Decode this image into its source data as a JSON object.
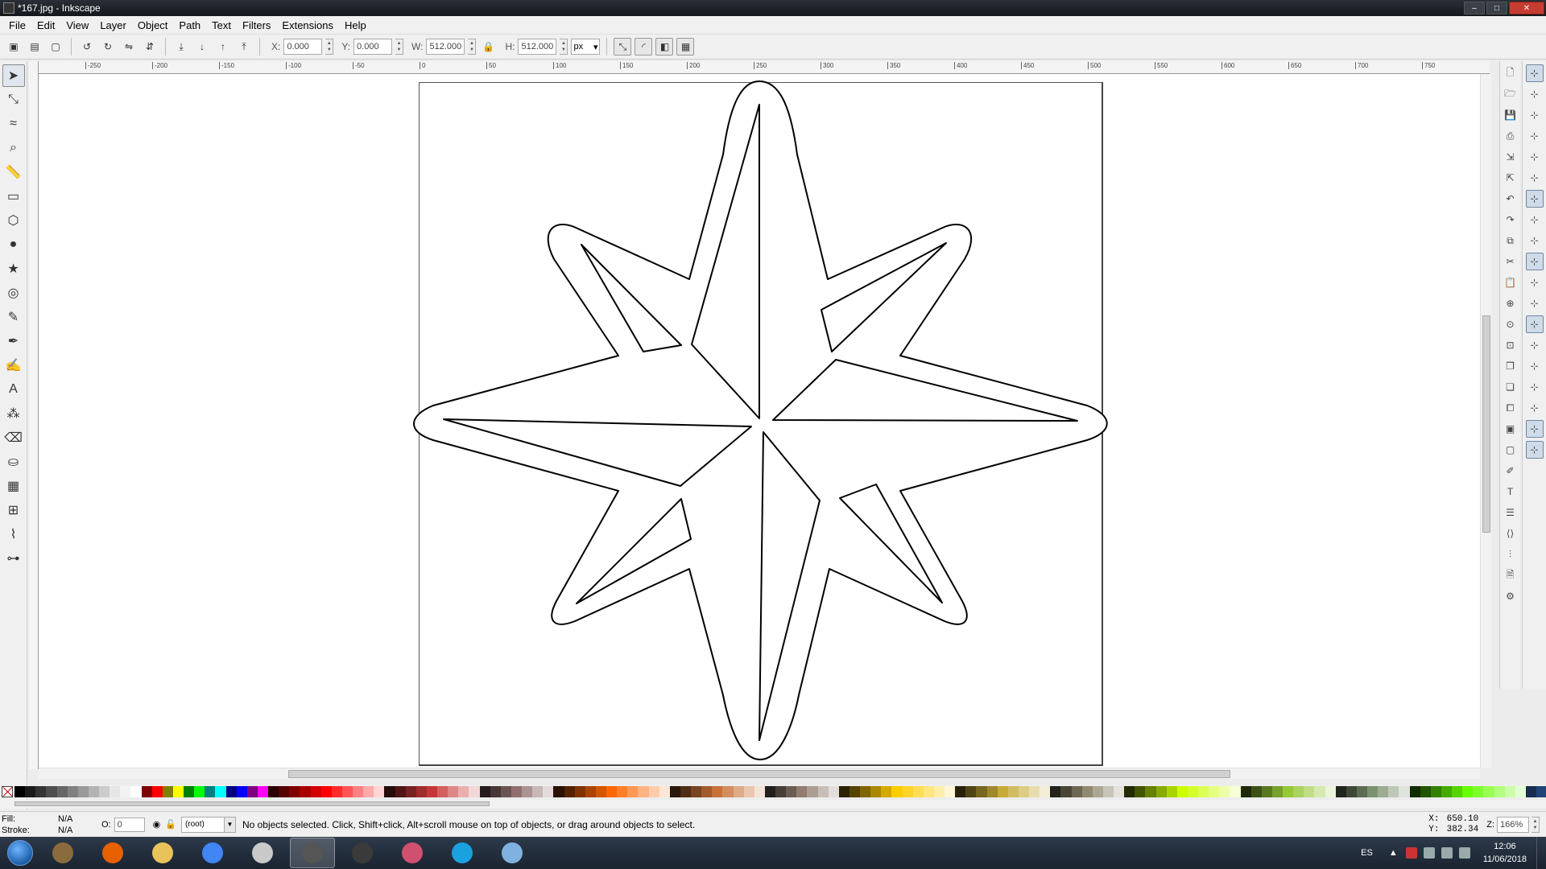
{
  "window": {
    "title": "*167.jpg - Inkscape",
    "min_glyph": "–",
    "max_glyph": "□",
    "close_glyph": "✕"
  },
  "menu": [
    "File",
    "Edit",
    "View",
    "Layer",
    "Object",
    "Path",
    "Text",
    "Filters",
    "Extensions",
    "Help"
  ],
  "controls": {
    "x_label": "X:",
    "x_value": "0.000",
    "y_label": "Y:",
    "y_value": "0.000",
    "w_label": "W:",
    "w_value": "512.000",
    "h_label": "H:",
    "h_value": "512.000",
    "unit": "px"
  },
  "ruler_labels": [
    "-250",
    "-200",
    "-150",
    "-100",
    "-50",
    "0",
    "50",
    "100",
    "150",
    "200",
    "250",
    "300",
    "350",
    "400",
    "450",
    "500",
    "550",
    "600",
    "650",
    "700",
    "750"
  ],
  "tools": [
    {
      "name": "selector-tool-icon",
      "glyph": "➤",
      "active": true
    },
    {
      "name": "node-tool-icon",
      "glyph": "⤡"
    },
    {
      "name": "tweak-tool-icon",
      "glyph": "≈"
    },
    {
      "name": "zoom-tool-icon",
      "glyph": "⌕"
    },
    {
      "name": "measure-tool-icon",
      "glyph": "📏"
    },
    {
      "name": "rectangle-tool-icon",
      "glyph": "▭"
    },
    {
      "name": "3d-box-tool-icon",
      "glyph": "⬡"
    },
    {
      "name": "ellipse-tool-icon",
      "glyph": "●"
    },
    {
      "name": "star-tool-icon",
      "glyph": "★"
    },
    {
      "name": "spiral-tool-icon",
      "glyph": "◎"
    },
    {
      "name": "pencil-tool-icon",
      "glyph": "✎"
    },
    {
      "name": "pen-tool-icon",
      "glyph": "✒"
    },
    {
      "name": "calligraphy-tool-icon",
      "glyph": "✍"
    },
    {
      "name": "text-tool-icon",
      "glyph": "A"
    },
    {
      "name": "spray-tool-icon",
      "glyph": "⁂"
    },
    {
      "name": "eraser-tool-icon",
      "glyph": "⌫"
    },
    {
      "name": "paint-bucket-tool-icon",
      "glyph": "⛀"
    },
    {
      "name": "gradient-tool-icon",
      "glyph": "▦"
    },
    {
      "name": "mesh-tool-icon",
      "glyph": "⊞"
    },
    {
      "name": "dropper-tool-icon",
      "glyph": "⌇"
    },
    {
      "name": "connector-tool-icon",
      "glyph": "⊶"
    }
  ],
  "commands": [
    {
      "name": "new-document-icon",
      "glyph": "🗋"
    },
    {
      "name": "open-document-icon",
      "glyph": "🗁"
    },
    {
      "name": "save-document-icon",
      "glyph": "💾"
    },
    {
      "name": "print-document-icon",
      "glyph": "⎙"
    },
    {
      "name": "import-icon",
      "glyph": "⇲"
    },
    {
      "name": "export-icon",
      "glyph": "⇱"
    },
    {
      "name": "undo-icon",
      "glyph": "↶"
    },
    {
      "name": "redo-icon",
      "glyph": "↷"
    },
    {
      "name": "copy-icon",
      "glyph": "⧉"
    },
    {
      "name": "cut-icon",
      "glyph": "✂"
    },
    {
      "name": "paste-icon",
      "glyph": "📋"
    },
    {
      "name": "zoom-selection-icon",
      "glyph": "⊕"
    },
    {
      "name": "zoom-drawing-icon",
      "glyph": "⊙"
    },
    {
      "name": "zoom-page-icon",
      "glyph": "⊡"
    },
    {
      "name": "duplicate-icon",
      "glyph": "❐"
    },
    {
      "name": "clone-icon",
      "glyph": "❏"
    },
    {
      "name": "unlink-clone-icon",
      "glyph": "⧠"
    },
    {
      "name": "group-icon",
      "glyph": "▣"
    },
    {
      "name": "ungroup-icon",
      "glyph": "▢"
    },
    {
      "name": "fill-stroke-icon",
      "glyph": "✐"
    },
    {
      "name": "text-font-icon",
      "glyph": "T"
    },
    {
      "name": "layers-icon",
      "glyph": "☰"
    },
    {
      "name": "xml-editor-icon",
      "glyph": "⟨⟩"
    },
    {
      "name": "align-distribute-icon",
      "glyph": "⫶"
    },
    {
      "name": "document-properties-icon",
      "glyph": "🗎"
    },
    {
      "name": "preferences-icon",
      "glyph": "⚙"
    }
  ],
  "snaps": [
    {
      "name": "snap-enable-icon",
      "on": true
    },
    {
      "name": "snap-bbox-icon"
    },
    {
      "name": "snap-bbox-edge-icon"
    },
    {
      "name": "snap-bbox-corner-icon"
    },
    {
      "name": "snap-bbox-midpoint-icon"
    },
    {
      "name": "snap-bbox-center-icon"
    },
    {
      "name": "snap-nodes-icon",
      "on": true
    },
    {
      "name": "snap-path-icon"
    },
    {
      "name": "snap-intersection-icon"
    },
    {
      "name": "snap-cusp-node-icon",
      "on": true
    },
    {
      "name": "snap-smooth-node-icon"
    },
    {
      "name": "snap-midpoint-icon"
    },
    {
      "name": "snap-center-icon",
      "on": true
    },
    {
      "name": "snap-rotation-center-icon"
    },
    {
      "name": "snap-object-midpoint-icon"
    },
    {
      "name": "snap-text-baseline-icon"
    },
    {
      "name": "snap-page-border-icon"
    },
    {
      "name": "snap-grid-icon",
      "on": true
    },
    {
      "name": "snap-guide-icon",
      "on": true
    }
  ],
  "palette_colors": [
    "#000000",
    "#1a1a1a",
    "#333333",
    "#4d4d4d",
    "#666666",
    "#808080",
    "#999999",
    "#b3b3b3",
    "#cccccc",
    "#e6e6e6",
    "#f2f2f2",
    "#ffffff",
    "#800000",
    "#ff0000",
    "#808000",
    "#ffff00",
    "#008000",
    "#00ff00",
    "#008080",
    "#00ffff",
    "#000080",
    "#0000ff",
    "#800080",
    "#ff00ff",
    "#2b0000",
    "#550000",
    "#800000",
    "#aa0000",
    "#d40000",
    "#ff0000",
    "#ff2a2a",
    "#ff5555",
    "#ff8080",
    "#ffaaaa",
    "#ffd5d5",
    "#280b0b",
    "#501616",
    "#782121",
    "#a02c2c",
    "#c83737",
    "#d35f5f",
    "#de8787",
    "#e9afaf",
    "#f4d7d7",
    "#241c1c",
    "#483737",
    "#6c5353",
    "#916f6f",
    "#ac9393",
    "#c8b7b7",
    "#e3dbdb",
    "#2b1100",
    "#552200",
    "#803300",
    "#aa4400",
    "#d45500",
    "#ff6600",
    "#ff7f2a",
    "#ff9955",
    "#ffb380",
    "#ffccaa",
    "#ffe6d5",
    "#28170b",
    "#502d16",
    "#784421",
    "#a05a2c",
    "#c87137",
    "#d38d5f",
    "#deaa87",
    "#e9c6af",
    "#f4e3d7",
    "#241f1c",
    "#483e37",
    "#6c5d53",
    "#917c6f",
    "#ac9d93",
    "#c8beb7",
    "#e3dedb",
    "#2b2200",
    "#554400",
    "#806600",
    "#aa8800",
    "#d4aa00",
    "#ffcc00",
    "#ffd42a",
    "#ffdd55",
    "#ffe680",
    "#ffeeaa",
    "#fff6d5",
    "#28220b",
    "#504416",
    "#786721",
    "#a0892c",
    "#c8ab37",
    "#d3bc5f",
    "#decd87",
    "#e9ddaf",
    "#f4eed7",
    "#24221c",
    "#484537",
    "#6c6753",
    "#918a6f",
    "#aca793",
    "#c8c4b7",
    "#e3e2db",
    "#222b00",
    "#445500",
    "#668000",
    "#88aa00",
    "#aad400",
    "#ccff00",
    "#d4ff2a",
    "#ddff55",
    "#e5ff80",
    "#eeffaa",
    "#f6ffd5",
    "#1e280b",
    "#3c5016",
    "#5a7821",
    "#78a02c",
    "#96c837",
    "#abd35f",
    "#c1de87",
    "#d6e9af",
    "#ebf4d7",
    "#1f241c",
    "#3e4837",
    "#5d6c53",
    "#7c916f",
    "#9dac93",
    "#bec8b7",
    "#dee3db",
    "#112b00",
    "#225500",
    "#338000",
    "#44aa00",
    "#55d400",
    "#66ff00",
    "#7fff2a",
    "#99ff55",
    "#b3ff80",
    "#ccffaa",
    "#e5ffd5",
    "#162d50",
    "#214478"
  ],
  "status": {
    "fill_label": "Fill:",
    "fill_value": "N/A",
    "stroke_label": "Stroke:",
    "stroke_value": "N/A",
    "opacity_label": "O:",
    "opacity_value": "0",
    "layer": "(root)",
    "message": "No objects selected. Click, Shift+click, Alt+scroll mouse on top of objects, or drag around objects to select.",
    "x_label": "X:",
    "x_value": "650.10",
    "y_label": "Y:",
    "y_value": "382.34",
    "zoom_label": "Z:",
    "zoom_value": "166%"
  },
  "taskbar": {
    "apps": [
      {
        "name": "taskbar-winrar",
        "color": "#8a6b3d"
      },
      {
        "name": "taskbar-firefox",
        "color": "#e66000"
      },
      {
        "name": "taskbar-explorer",
        "color": "#e8c35a"
      },
      {
        "name": "taskbar-chrome",
        "color": "#4285f4"
      },
      {
        "name": "taskbar-app-5",
        "color": "#c9c9c9"
      },
      {
        "name": "taskbar-inkscape",
        "color": "#555555",
        "active": true
      },
      {
        "name": "taskbar-obs",
        "color": "#3a3a3a"
      },
      {
        "name": "taskbar-app-8",
        "color": "#d05070"
      },
      {
        "name": "taskbar-ccleaner",
        "color": "#1aa1e0"
      },
      {
        "name": "taskbar-paint",
        "color": "#7fb2e0"
      }
    ],
    "lang": "ES",
    "time": "12:06",
    "date": "11/06/2018"
  }
}
